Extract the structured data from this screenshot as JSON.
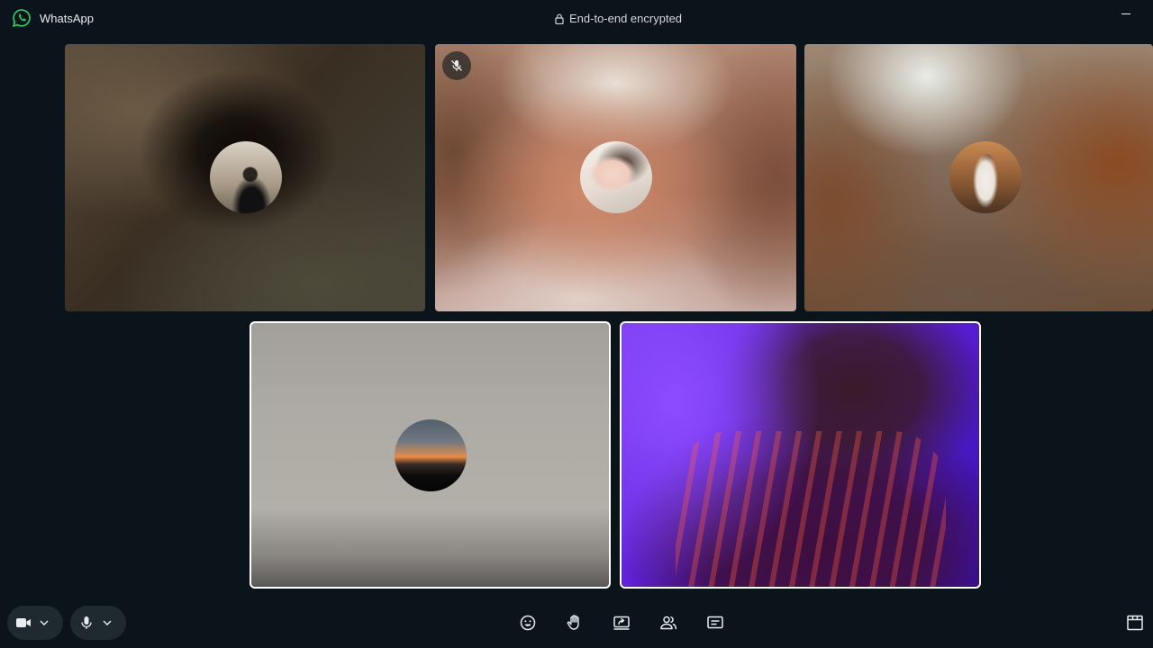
{
  "app": {
    "title": "WhatsApp",
    "encryption_label": "End-to-end encrypted"
  },
  "participants": [
    {
      "id": 1,
      "muted": false,
      "speaking": false
    },
    {
      "id": 2,
      "muted": true,
      "speaking": false
    },
    {
      "id": 3,
      "muted": false,
      "speaking": false
    },
    {
      "id": 4,
      "muted": false,
      "speaking": true
    },
    {
      "id": 5,
      "muted": false,
      "speaking": true,
      "camera_on": true
    }
  ],
  "controls": {
    "camera_icon": "video-camera-icon",
    "mic_icon": "microphone-icon",
    "toolbar_icons": [
      "emoji-reaction-icon",
      "raise-hand-icon",
      "screen-share-icon",
      "participants-icon",
      "captions-icon"
    ],
    "layout_icon": "layout-icon"
  },
  "colors": {
    "background": "#0b141a",
    "whatsapp_green": "#25d366",
    "speaking_border": "#ffffff",
    "control_pill": "#1f2a30"
  }
}
